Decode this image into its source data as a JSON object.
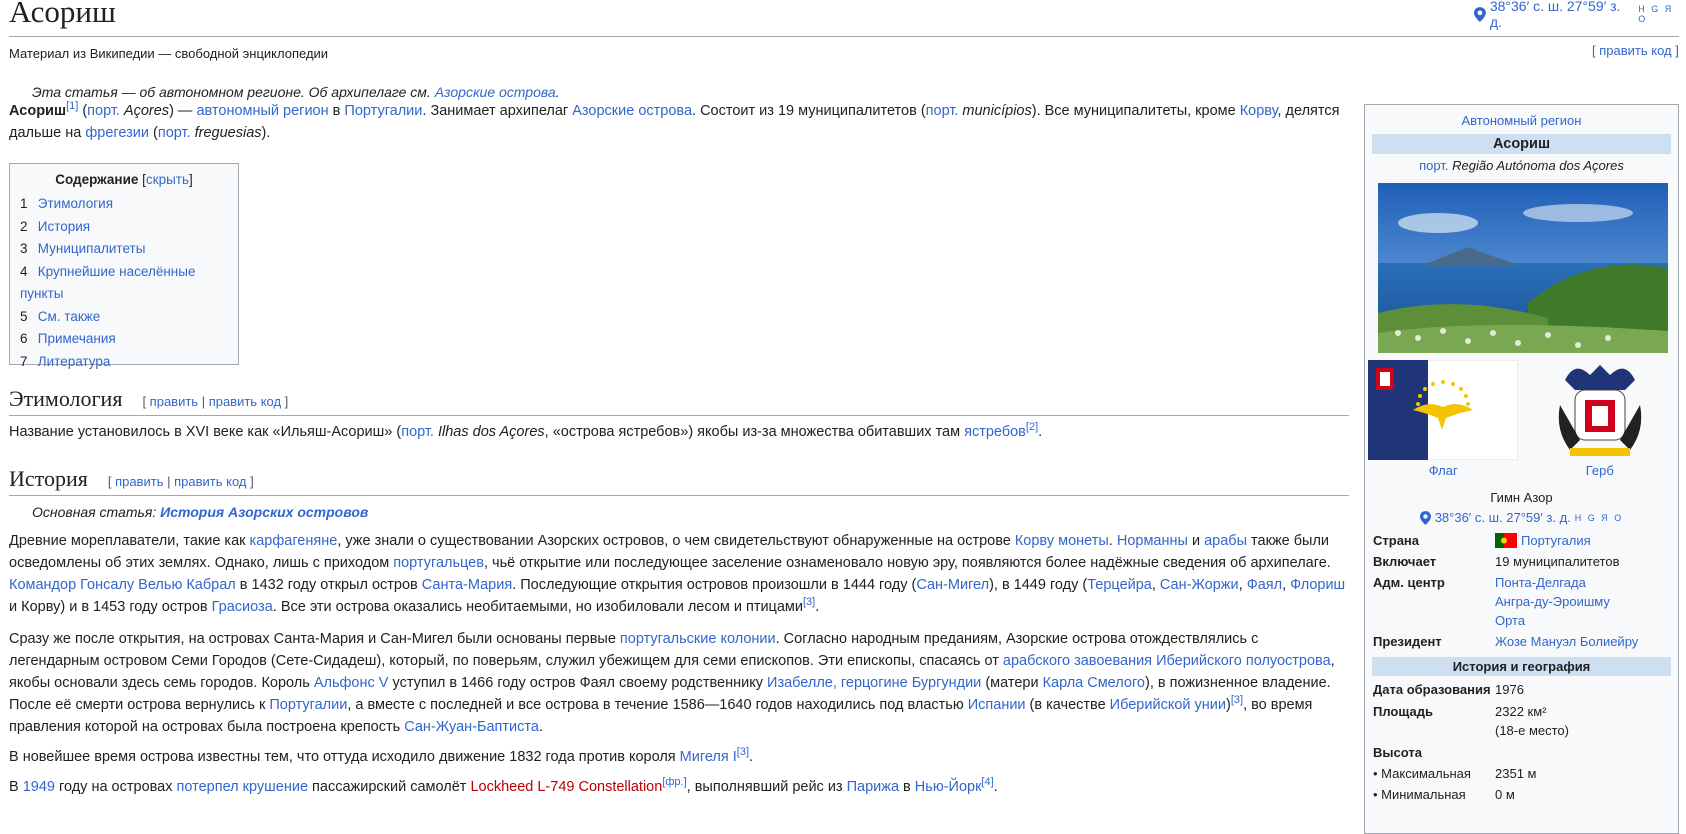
{
  "header": {
    "title": "Асориш",
    "coords": "38°36′ с. ш. 27°59′ з. д.",
    "coords_hgyo": "H G Я O",
    "subtitle": "Материал из Википедии — свободной энциклопедии",
    "edit_code": "[ править код ]"
  },
  "hatnote": {
    "prefix": "Эта статья — об автономном регионе. Об архипелаге см. ",
    "link": "Азорские острова",
    "suffix": "."
  },
  "lead": {
    "s1": "Асориш",
    "s2": "[1]",
    "s3": " (",
    "s4": "порт.",
    "s5": " Açores",
    "s6": ") — ",
    "s7": "автономный регион",
    "s8": " в ",
    "s9": "Португалии",
    "s10": ". Занимает архипелаг ",
    "s11": "Азорские острова",
    "s12": ". Состоит из 19 муниципалитетов (",
    "s13": "порт.",
    "s14": " municípios",
    "s15": "). Все муниципалитеты, кроме ",
    "s16": "Корву",
    "s17": ", делятся дальше на ",
    "s18": "фрегезии",
    "s19": " (",
    "s20": "порт.",
    "s21": " freguesias",
    "s22": ")."
  },
  "toc": {
    "title": "Содержание",
    "hide": "скрыть",
    "items": [
      {
        "num": "1",
        "label": "Этимология"
      },
      {
        "num": "2",
        "label": "История"
      },
      {
        "num": "3",
        "label": "Муниципалитеты"
      },
      {
        "num": "4",
        "label": "Крупнейшие населённые пункты"
      },
      {
        "num": "5",
        "label": "См. также"
      },
      {
        "num": "6",
        "label": "Примечания"
      },
      {
        "num": "7",
        "label": "Литература"
      }
    ]
  },
  "sections": {
    "etymology": {
      "title": "Этимология",
      "edit": "править",
      "sep": " | ",
      "edit_code": "править код"
    },
    "history": {
      "title": "История",
      "edit": "править",
      "sep": " | ",
      "edit_code": "править код"
    }
  },
  "etym_p": {
    "s1": "Название установилось в XVI веке как «Ильяш-Асориш» (",
    "s2": "порт.",
    "s3": " Ilhas dos Açores",
    "s4": ", «острова ястребов») якобы из-за множества обитавших там ",
    "s5": "ястребов",
    "s6": "[2]",
    "s7": "."
  },
  "hist_hat": {
    "prefix": "Основная статья: ",
    "link": "История Азорских островов"
  },
  "p1": {
    "s1": "Древние мореплаватели, такие как ",
    "s2": "карфагеняне",
    "s3": ", уже знали о существовании Азорских островов, о чем свидетельствуют обнаруженные на острове ",
    "s4": "Корву",
    "s5": " ",
    "s6": "монеты",
    "s7": ". ",
    "s8": "Норманны",
    "s9": " и ",
    "s10": "арабы",
    "s11": " также были осведомлены об этих землях. Однако, лишь с приходом ",
    "s12": "португальцев",
    "s13": ", чьё открытие или последующее заселение ознаменовало новую эру, появляются более надёжные сведения об архипелаге. ",
    "s14": "Командор",
    "s15": " ",
    "s16": "Гонсалу Велью Кабрал",
    "s17": " в 1432 году открыл остров ",
    "s18": "Санта-Мария",
    "s19": ". Последующие открытия островов произошли в 1444 году (",
    "s20": "Сан-Мигел",
    "s21": "), в 1449 году (",
    "s22": "Терцейра",
    "s23": ", ",
    "s24": "Сан-Жоржи",
    "s25": ", ",
    "s26": "Фаял",
    "s27": ", ",
    "s28": "Флориш",
    "s29": " и Корву) и в 1453 году остров ",
    "s30": "Грасиоза",
    "s31": ". Все эти острова оказались необитаемыми, но изобиловали лесом и птицами",
    "s32": "[3]",
    "s33": "."
  },
  "p2": {
    "s1": "Сразу же после открытия, на островах Санта-Мария и Сан-Мигел были основаны первые ",
    "s2": "португальские колонии",
    "s3": ". Согласно народным преданиям, Азорские острова отождествлялись с легендарным островом Семи Городов (Сете-Сидадеш), который, по поверьям, служил убежищем для семи епископов. Эти епископы, спасаясь от ",
    "s4": "арабского завоевания Иберийского полуострова",
    "s5": ", якобы основали здесь семь городов. Король ",
    "s6": "Альфонс V",
    "s7": " уступил в 1466 году остров Фаял своему родственнику ",
    "s8": "Изабелле, герцогине Бургундии",
    "s9": " (матери ",
    "s10": "Карла Смелого",
    "s11": "), в пожизненное владение. После её смерти острова вернулись к ",
    "s12": "Португалии",
    "s13": ", а вместе с последней и все острова в течение 1586—1640 годов находились под властью ",
    "s14": "Испании",
    "s15": " (в качестве ",
    "s16": "Иберийской унии",
    "s17": ")",
    "s18": "[3]",
    "s19": ", во время правления которой на островах была построена крепость ",
    "s20": "Сан-Жуан-Баптиста",
    "s21": "."
  },
  "p3": {
    "s1": "В новейшее время острова известны тем, что оттуда исходило движение 1832 года против короля ",
    "s2": "Мигеля I",
    "s3": "[3]",
    "s4": "."
  },
  "p4": {
    "s1": "В ",
    "s2": "1949",
    "s3": " году на островах ",
    "s4": "потерпел крушение",
    "s5": " пассажирский самолёт ",
    "s6": "Lockheed L-749 Constellation",
    "s7": "[фр.]",
    "s8": ", выполнявший рейс из ",
    "s9": "Парижа",
    "s10": " в ",
    "s11": "Нью-Йорк",
    "s12": "[4]",
    "s13": "."
  },
  "infobox": {
    "type": "Автономный регион",
    "name": "Асориш",
    "orig_lang": "порт.",
    "orig_name": " Região Autónoma dos Açores",
    "flag_label": "Флаг",
    "arms_label": "Герб",
    "anthem": "Гимн Азор",
    "coords": "38°36′ с. ш. 27°59′ з. д.",
    "coords_hgyo": "H G Я O",
    "rows": [
      {
        "label": "Страна",
        "value": "Португалия"
      },
      {
        "label": "Включает",
        "value": "19 муниципалитетов"
      },
      {
        "label": "Адм. центр",
        "value1": "Понта-Делгада",
        "value2": "Ангра-ду-Эроишму",
        "value3": "Орта"
      },
      {
        "label": "Президент",
        "value": "Жозе Мануэл Болиейру"
      }
    ],
    "section2": "История и география",
    "founded_label": "Дата образования",
    "founded": "1976",
    "area_label": "Площадь",
    "area": "2322 км²",
    "area_rank": "(18-е место)",
    "height_label": "Высота",
    "max_label": "• Максимальная",
    "max": "2351 м",
    "min_label": "• Минимальная",
    "min": "0 м"
  },
  "colors": {
    "link": "#3366cc",
    "redlink": "#ba0000",
    "header_bg": "#cedff2",
    "box_bg": "#f8f9fa",
    "border": "#a2a9b1"
  }
}
